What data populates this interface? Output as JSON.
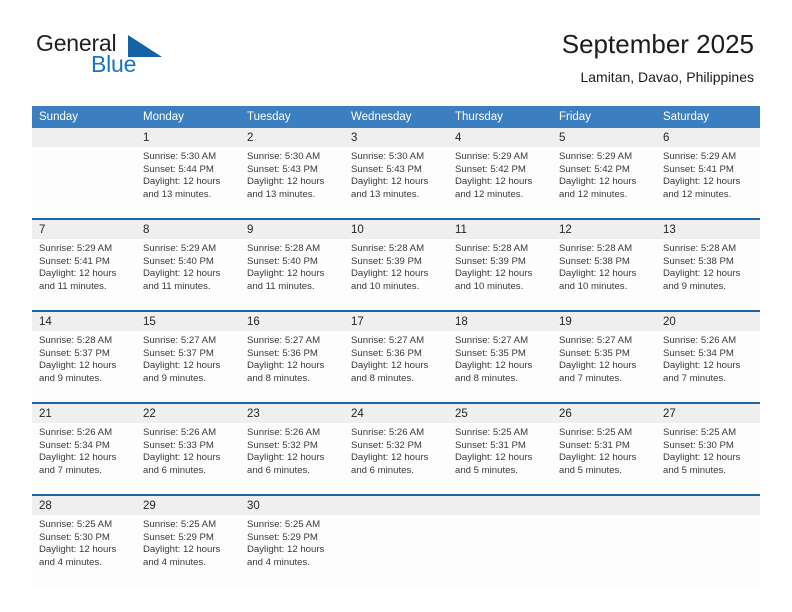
{
  "logo": {
    "word_one": "General",
    "word_two": "Blue",
    "triangle_color": "#1464a5",
    "blue_text_color": "#1a73c4"
  },
  "header": {
    "title": "September 2025",
    "subtitle": "Lamitan, Davao, Philippines"
  },
  "theme": {
    "header_bg": "#3c7fc1",
    "row_divider": "#1c63a8",
    "daynum_bg": "#efeff0",
    "cell_bg": "#fdfdfd"
  },
  "weekday_headers": [
    "Sunday",
    "Monday",
    "Tuesday",
    "Wednesday",
    "Thursday",
    "Friday",
    "Saturday"
  ],
  "weeks": [
    [
      {
        "day": "",
        "sunrise": "",
        "sunset": "",
        "daylight_line1": "",
        "daylight_line2": ""
      },
      {
        "day": "1",
        "sunrise": "Sunrise: 5:30 AM",
        "sunset": "Sunset: 5:44 PM",
        "daylight_line1": "Daylight: 12 hours",
        "daylight_line2": "and 13 minutes."
      },
      {
        "day": "2",
        "sunrise": "Sunrise: 5:30 AM",
        "sunset": "Sunset: 5:43 PM",
        "daylight_line1": "Daylight: 12 hours",
        "daylight_line2": "and 13 minutes."
      },
      {
        "day": "3",
        "sunrise": "Sunrise: 5:30 AM",
        "sunset": "Sunset: 5:43 PM",
        "daylight_line1": "Daylight: 12 hours",
        "daylight_line2": "and 13 minutes."
      },
      {
        "day": "4",
        "sunrise": "Sunrise: 5:29 AM",
        "sunset": "Sunset: 5:42 PM",
        "daylight_line1": "Daylight: 12 hours",
        "daylight_line2": "and 12 minutes."
      },
      {
        "day": "5",
        "sunrise": "Sunrise: 5:29 AM",
        "sunset": "Sunset: 5:42 PM",
        "daylight_line1": "Daylight: 12 hours",
        "daylight_line2": "and 12 minutes."
      },
      {
        "day": "6",
        "sunrise": "Sunrise: 5:29 AM",
        "sunset": "Sunset: 5:41 PM",
        "daylight_line1": "Daylight: 12 hours",
        "daylight_line2": "and 12 minutes."
      }
    ],
    [
      {
        "day": "7",
        "sunrise": "Sunrise: 5:29 AM",
        "sunset": "Sunset: 5:41 PM",
        "daylight_line1": "Daylight: 12 hours",
        "daylight_line2": "and 11 minutes."
      },
      {
        "day": "8",
        "sunrise": "Sunrise: 5:29 AM",
        "sunset": "Sunset: 5:40 PM",
        "daylight_line1": "Daylight: 12 hours",
        "daylight_line2": "and 11 minutes."
      },
      {
        "day": "9",
        "sunrise": "Sunrise: 5:28 AM",
        "sunset": "Sunset: 5:40 PM",
        "daylight_line1": "Daylight: 12 hours",
        "daylight_line2": "and 11 minutes."
      },
      {
        "day": "10",
        "sunrise": "Sunrise: 5:28 AM",
        "sunset": "Sunset: 5:39 PM",
        "daylight_line1": "Daylight: 12 hours",
        "daylight_line2": "and 10 minutes."
      },
      {
        "day": "11",
        "sunrise": "Sunrise: 5:28 AM",
        "sunset": "Sunset: 5:39 PM",
        "daylight_line1": "Daylight: 12 hours",
        "daylight_line2": "and 10 minutes."
      },
      {
        "day": "12",
        "sunrise": "Sunrise: 5:28 AM",
        "sunset": "Sunset: 5:38 PM",
        "daylight_line1": "Daylight: 12 hours",
        "daylight_line2": "and 10 minutes."
      },
      {
        "day": "13",
        "sunrise": "Sunrise: 5:28 AM",
        "sunset": "Sunset: 5:38 PM",
        "daylight_line1": "Daylight: 12 hours",
        "daylight_line2": "and 9 minutes."
      }
    ],
    [
      {
        "day": "14",
        "sunrise": "Sunrise: 5:28 AM",
        "sunset": "Sunset: 5:37 PM",
        "daylight_line1": "Daylight: 12 hours",
        "daylight_line2": "and 9 minutes."
      },
      {
        "day": "15",
        "sunrise": "Sunrise: 5:27 AM",
        "sunset": "Sunset: 5:37 PM",
        "daylight_line1": "Daylight: 12 hours",
        "daylight_line2": "and 9 minutes."
      },
      {
        "day": "16",
        "sunrise": "Sunrise: 5:27 AM",
        "sunset": "Sunset: 5:36 PM",
        "daylight_line1": "Daylight: 12 hours",
        "daylight_line2": "and 8 minutes."
      },
      {
        "day": "17",
        "sunrise": "Sunrise: 5:27 AM",
        "sunset": "Sunset: 5:36 PM",
        "daylight_line1": "Daylight: 12 hours",
        "daylight_line2": "and 8 minutes."
      },
      {
        "day": "18",
        "sunrise": "Sunrise: 5:27 AM",
        "sunset": "Sunset: 5:35 PM",
        "daylight_line1": "Daylight: 12 hours",
        "daylight_line2": "and 8 minutes."
      },
      {
        "day": "19",
        "sunrise": "Sunrise: 5:27 AM",
        "sunset": "Sunset: 5:35 PM",
        "daylight_line1": "Daylight: 12 hours",
        "daylight_line2": "and 7 minutes."
      },
      {
        "day": "20",
        "sunrise": "Sunrise: 5:26 AM",
        "sunset": "Sunset: 5:34 PM",
        "daylight_line1": "Daylight: 12 hours",
        "daylight_line2": "and 7 minutes."
      }
    ],
    [
      {
        "day": "21",
        "sunrise": "Sunrise: 5:26 AM",
        "sunset": "Sunset: 5:34 PM",
        "daylight_line1": "Daylight: 12 hours",
        "daylight_line2": "and 7 minutes."
      },
      {
        "day": "22",
        "sunrise": "Sunrise: 5:26 AM",
        "sunset": "Sunset: 5:33 PM",
        "daylight_line1": "Daylight: 12 hours",
        "daylight_line2": "and 6 minutes."
      },
      {
        "day": "23",
        "sunrise": "Sunrise: 5:26 AM",
        "sunset": "Sunset: 5:32 PM",
        "daylight_line1": "Daylight: 12 hours",
        "daylight_line2": "and 6 minutes."
      },
      {
        "day": "24",
        "sunrise": "Sunrise: 5:26 AM",
        "sunset": "Sunset: 5:32 PM",
        "daylight_line1": "Daylight: 12 hours",
        "daylight_line2": "and 6 minutes."
      },
      {
        "day": "25",
        "sunrise": "Sunrise: 5:25 AM",
        "sunset": "Sunset: 5:31 PM",
        "daylight_line1": "Daylight: 12 hours",
        "daylight_line2": "and 5 minutes."
      },
      {
        "day": "26",
        "sunrise": "Sunrise: 5:25 AM",
        "sunset": "Sunset: 5:31 PM",
        "daylight_line1": "Daylight: 12 hours",
        "daylight_line2": "and 5 minutes."
      },
      {
        "day": "27",
        "sunrise": "Sunrise: 5:25 AM",
        "sunset": "Sunset: 5:30 PM",
        "daylight_line1": "Daylight: 12 hours",
        "daylight_line2": "and 5 minutes."
      }
    ],
    [
      {
        "day": "28",
        "sunrise": "Sunrise: 5:25 AM",
        "sunset": "Sunset: 5:30 PM",
        "daylight_line1": "Daylight: 12 hours",
        "daylight_line2": "and 4 minutes."
      },
      {
        "day": "29",
        "sunrise": "Sunrise: 5:25 AM",
        "sunset": "Sunset: 5:29 PM",
        "daylight_line1": "Daylight: 12 hours",
        "daylight_line2": "and 4 minutes."
      },
      {
        "day": "30",
        "sunrise": "Sunrise: 5:25 AM",
        "sunset": "Sunset: 5:29 PM",
        "daylight_line1": "Daylight: 12 hours",
        "daylight_line2": "and 4 minutes."
      },
      {
        "day": "",
        "sunrise": "",
        "sunset": "",
        "daylight_line1": "",
        "daylight_line2": ""
      },
      {
        "day": "",
        "sunrise": "",
        "sunset": "",
        "daylight_line1": "",
        "daylight_line2": ""
      },
      {
        "day": "",
        "sunrise": "",
        "sunset": "",
        "daylight_line1": "",
        "daylight_line2": ""
      },
      {
        "day": "",
        "sunrise": "",
        "sunset": "",
        "daylight_line1": "",
        "daylight_line2": ""
      }
    ]
  ]
}
